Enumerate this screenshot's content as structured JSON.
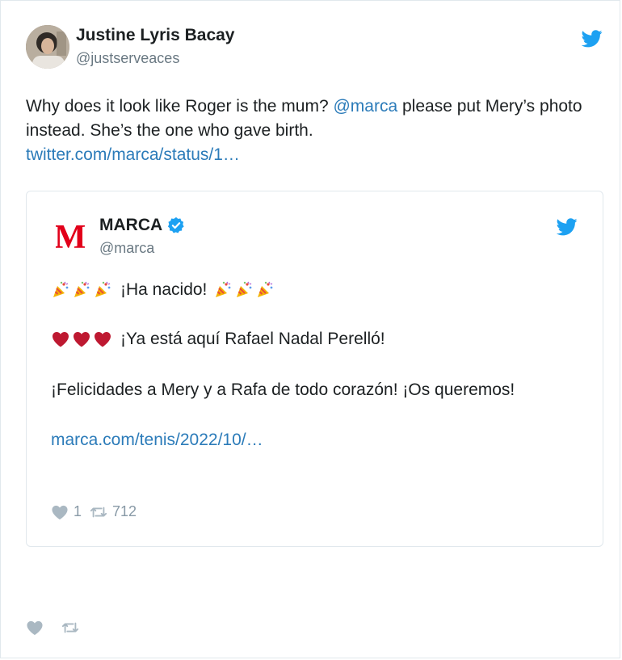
{
  "tweet": {
    "author_name": "Justine Lyris Bacay",
    "author_handle": "@justserveaces",
    "text_before_mention": "Why does it look like Roger is the mum? ",
    "mention": "@marca",
    "text_after_mention": " please put Mery’s photo instead. She’s the one who gave birth.",
    "link": "twitter.com/marca/status/1…",
    "bird_icon": "twitter-bird-icon",
    "actions": {
      "like_icon": "heart-icon",
      "retweet_icon": "retweet-icon"
    }
  },
  "quoted": {
    "author_name": "MARCA",
    "author_handle": "@marca",
    "logo_letter": "M",
    "verified_icon": "verified-badge-icon",
    "line1_text": "¡Ha nacido!",
    "line1_emoji": "party-popper-icon",
    "line2_text": "¡Ya está aquí Rafael Nadal Perelló!",
    "line2_emoji": "red-heart-icon",
    "line3_text": "¡Felicidades a Mery y a Rafa de todo corazón! ¡Os queremos!",
    "link": "marca.com/tenis/2022/10/…",
    "likes": "1",
    "retweets": "712"
  },
  "colors": {
    "link": "#2b7bb9",
    "twitter_blue": "#1da1f2",
    "marca_red": "#e2001a",
    "muted": "#8899a6"
  }
}
